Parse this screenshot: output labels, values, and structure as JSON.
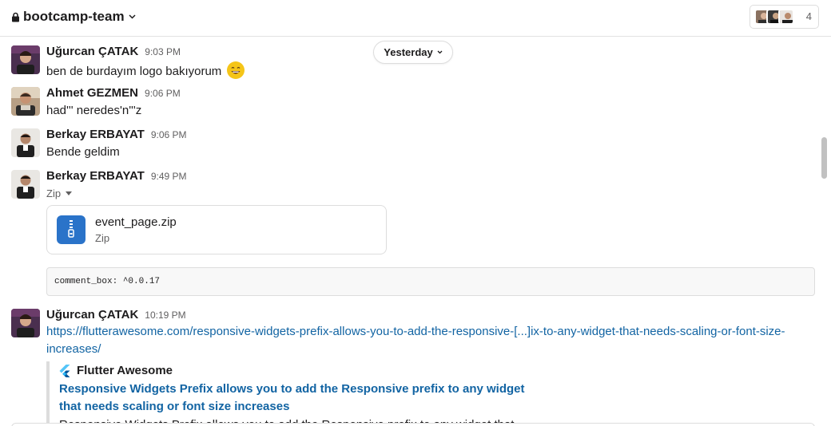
{
  "header": {
    "channel_name": "bootcamp-team",
    "member_count": "4"
  },
  "date_divider": {
    "label": "Yesterday"
  },
  "messages": [
    {
      "author": "Uğurcan ÇATAK",
      "time": "9:03 PM",
      "text": "ben de burdayım logo bakıyorum"
    },
    {
      "author": "Ahmet GEZMEN",
      "time": "9:06 PM",
      "text": "had''' neredes'n'''z"
    },
    {
      "author": "Berkay ERBAYAT",
      "time": "9:06 PM",
      "text": "Bende geldim"
    },
    {
      "author": "Berkay ERBAYAT",
      "time": "9:49 PM",
      "attachment_label": "Zip",
      "file": {
        "name": "event_page.zip",
        "type": "Zip"
      },
      "code": "comment_box: ^0.0.17"
    },
    {
      "author": "Uğurcan ÇATAK",
      "time": "10:19 PM",
      "link": "https://flutterawesome.com/responsive-widgets-prefix-allows-you-to-add-the-responsive-[...]ix-to-any-widget-that-needs-scaling-or-font-size-increases/",
      "unfurl": {
        "source": "Flutter Awesome",
        "title": "Responsive Widgets Prefix allows you to add the Responsive prefix to any widget that needs scaling or font size increases",
        "description": "Responsive Widgets Prefix allows you to add the Responsive prefix to any widget that"
      }
    }
  ],
  "colors": {
    "link": "#1264a3",
    "file_icon": "#2a73c9",
    "emoji": "#f5c518"
  },
  "icons": [
    "lock-icon",
    "chevron-down-icon",
    "smiley-emoji-icon",
    "zip-file-icon",
    "flutter-logo-icon"
  ]
}
